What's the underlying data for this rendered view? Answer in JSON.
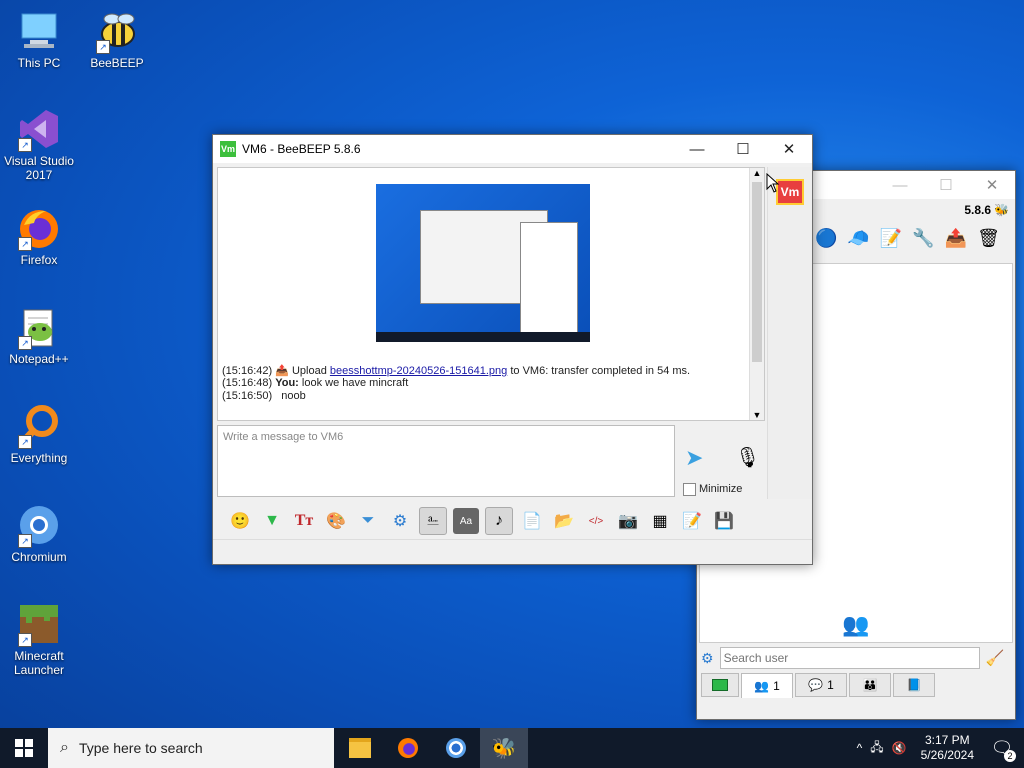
{
  "desktop": {
    "icons": [
      {
        "label": "This PC"
      },
      {
        "label": "BeeBEEP"
      },
      {
        "label": "Visual Studio 2017"
      },
      {
        "label": "Firefox"
      },
      {
        "label": "Notepad++"
      },
      {
        "label": "Everything"
      },
      {
        "label": "Chromium"
      },
      {
        "label": "Minecraft Launcher"
      }
    ]
  },
  "chat_window": {
    "title": "VM6 - BeeBEEP 5.8.6",
    "app_badge": "Vm",
    "messages": [
      {
        "time": "(15:16:42)",
        "prefix": "Upload",
        "link": "beesshottmp-20240526-151641.png",
        "suffix": "to VM6: transfer completed in 54 ms."
      },
      {
        "time": "(15:16:48)",
        "sender": "You:",
        "text": "look we have mincraft"
      },
      {
        "time": "(15:16:50)",
        "text": "noob"
      }
    ],
    "compose_placeholder": "Write a message to VM6",
    "minimize_label": "Minimize"
  },
  "main_window": {
    "version": "5.8.6",
    "search_placeholder": "Search user",
    "tabs": [
      {
        "count": "1"
      },
      {
        "count": "1"
      }
    ]
  },
  "taskbar": {
    "search_text": "Type here to search",
    "time": "3:17 PM",
    "date": "5/26/2024",
    "notification_count": "2"
  }
}
